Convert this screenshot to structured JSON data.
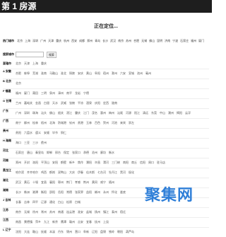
{
  "header": {
    "title": "第 1 房源"
  },
  "status": {
    "locating": "正在定位..."
  },
  "hot": {
    "label": "热门城市",
    "cities": [
      "北京",
      "上海",
      "深圳",
      "广州",
      "天津",
      "重庆",
      "杭州",
      "西安",
      "成都",
      "郑州",
      "青岛",
      "长沙",
      "武汉",
      "南京",
      "苏州",
      "合肥",
      "无锡",
      "佛山",
      "昆明",
      "济南",
      "宁波",
      "石家庄",
      "福州",
      "厦门"
    ]
  },
  "search": {
    "label": "搜索城市",
    "placeholder": "",
    "button": "搜索"
  },
  "rows": [
    {
      "key": "直辖市",
      "cities": [
        "北京",
        "天津",
        "上海",
        "重庆"
      ]
    },
    {
      "key": "A 安徽",
      "cities": [
        "合肥",
        "蚌埠",
        "芜湖",
        "淮南",
        "马鞍山",
        "淮北",
        "铜陵",
        "安庆",
        "黄山",
        "阜阳",
        "宿州",
        "滁州",
        "六安",
        "宣城",
        "池州",
        "亳州"
      ]
    },
    {
      "key": "B 北京",
      "cities": [
        "北京"
      ]
    },
    {
      "key": "F 福建",
      "cities": [
        "福州",
        "厦门",
        "莆田",
        "三明",
        "泉州",
        "漳州",
        "南平",
        "龙岩",
        "宁德"
      ]
    },
    {
      "key": "G 甘肃",
      "cities": [
        "兰州",
        "嘉峪关",
        "金昌",
        "白银",
        "天水",
        "武威",
        "张掖",
        "平凉",
        "酒泉",
        "庆阳",
        "定西",
        "陇南"
      ]
    },
    {
      "key": "广东",
      "cities": [
        "广州",
        "深圳",
        "珠海",
        "汕头",
        "佛山",
        "韶关",
        "湛江",
        "肇庆",
        "江门",
        "茂名",
        "惠州",
        "梅州",
        "汕尾",
        "河源",
        "阳江",
        "清远",
        "东莞",
        "中山",
        "潮州",
        "揭阳",
        "云浮"
      ]
    },
    {
      "key": "广西",
      "cities": [
        "南宁",
        "柳州",
        "桂林",
        "梧州",
        "北海",
        "防城港",
        "钦州",
        "贵港",
        "玉林",
        "百色",
        "贺州",
        "河池",
        "来宾",
        "崇左"
      ]
    },
    {
      "key": "贵州",
      "cities": [
        "贵阳",
        "六盘水",
        "遵义",
        "安顺",
        "毕节",
        "铜仁"
      ]
    },
    {
      "key": "H 海南",
      "cities": [
        "海口",
        "三亚",
        "三沙",
        "儋州"
      ]
    },
    {
      "key": "河北",
      "cities": [
        "石家庄",
        "唐山",
        "秦皇岛",
        "邯郸",
        "邢台",
        "保定",
        "张家口",
        "承德",
        "沧州",
        "廊坊",
        "衡水"
      ]
    },
    {
      "key": "河南",
      "cities": [
        "郑州",
        "开封",
        "洛阳",
        "平顶山",
        "安阳",
        "鹤壁",
        "新乡",
        "焦作",
        "濮阳",
        "许昌",
        "漯河",
        "三门峡",
        "南阳",
        "商丘",
        "信阳",
        "周口",
        "驻马店"
      ]
    },
    {
      "key": "黑龙江",
      "cities": [
        "哈尔滨",
        "齐齐哈尔",
        "鸡西",
        "鹤岗",
        "双鸭山",
        "大庆",
        "伊春",
        "佳木斯",
        "七台河",
        "牡丹江",
        "黑河",
        "绥化"
      ]
    },
    {
      "key": "湖北",
      "cities": [
        "武汉",
        "黄石",
        "十堰",
        "宜昌",
        "襄阳",
        "鄂州",
        "荆门",
        "孝感",
        "荆州",
        "黄冈",
        "咸宁",
        "随州"
      ]
    },
    {
      "key": "湖南",
      "cities": [
        "长沙",
        "株洲",
        "湘潭",
        "衡阳",
        "邵阳",
        "岳阳",
        "常德",
        "张家界",
        "益阳",
        "郴州",
        "永州",
        "怀化",
        "娄底"
      ]
    },
    {
      "key": "J 吉林",
      "cities": [
        "长春",
        "吉林",
        "四平",
        "辽源",
        "通化",
        "白山",
        "松原",
        "白城"
      ]
    },
    {
      "key": "江苏",
      "cities": [
        "南京",
        "无锡",
        "徐州",
        "常州",
        "苏州",
        "南通",
        "连云港",
        "淮安",
        "盐城",
        "扬州",
        "镇江",
        "泰州",
        "宿迁"
      ]
    },
    {
      "key": "江西",
      "cities": [
        "南昌",
        "景德镇",
        "萍乡",
        "九江",
        "新余",
        "鹰潭",
        "赣州",
        "吉安",
        "宜春",
        "抚州",
        "上饶"
      ]
    },
    {
      "key": "L 辽宁",
      "cities": [
        "沈阳",
        "大连",
        "鞍山",
        "抚顺",
        "本溪",
        "丹东",
        "锦州",
        "营口",
        "阜新",
        "辽阳",
        "盘锦",
        "铁岭",
        "朝阳",
        "葫芦岛"
      ]
    }
  ],
  "logo": {
    "text": "聚集网",
    "color": "#2f7fd8"
  }
}
